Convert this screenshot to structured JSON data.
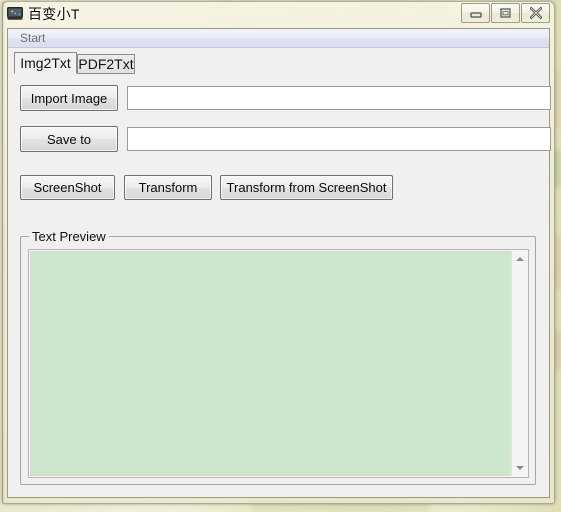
{
  "window": {
    "title": "百变小T",
    "icon": "app-monitor-icon",
    "controls": {
      "minimize": "minimize-icon",
      "maximize": "maximize-icon",
      "close": "close-icon"
    }
  },
  "menubar": {
    "items": [
      {
        "label": "Start"
      }
    ]
  },
  "tabs": [
    {
      "label": "Img2Txt",
      "active": true
    },
    {
      "label": "PDF2Txt",
      "active": false
    }
  ],
  "form": {
    "import_button": "Import Image",
    "import_value": "",
    "import_placeholder": "",
    "save_button": "Save to",
    "save_value": "",
    "save_placeholder": ""
  },
  "actions": [
    {
      "label": "ScreenShot"
    },
    {
      "label": "Transform"
    },
    {
      "label": "Transform from ScreenShot"
    }
  ],
  "preview": {
    "group_label": "Text Preview",
    "content": "",
    "background_color": "#cde7cd",
    "scrollbar": {
      "up_icon": "scroll-up-arrow-icon",
      "down_icon": "scroll-down-arrow-icon"
    }
  },
  "colors": {
    "glass_frame": "#eeedd4",
    "client_background": "#f0f0f0",
    "menubar_background": "#e6eaf5",
    "preview_green": "#cde7cd",
    "button_face": "#ededed"
  }
}
